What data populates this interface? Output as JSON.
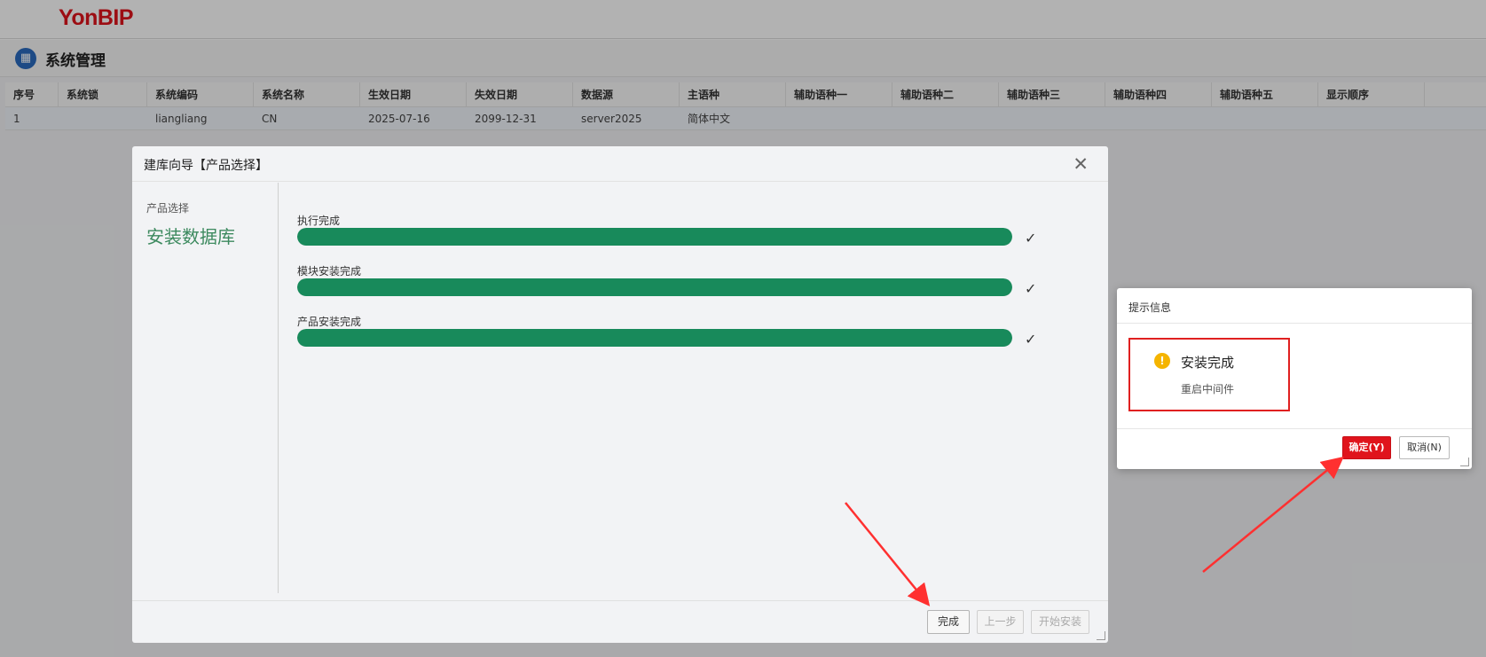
{
  "brand": {
    "logo_text": "YonBIP",
    "accent": "#e0141c"
  },
  "page": {
    "title": "系统管理",
    "title_icon": "grid-icon"
  },
  "table": {
    "columns": [
      "序号",
      "系统锁",
      "系统编码",
      "系统名称",
      "生效日期",
      "失效日期",
      "数据源",
      "主语种",
      "辅助语种一",
      "辅助语种二",
      "辅助语种三",
      "辅助语种四",
      "辅助语种五",
      "显示顺序"
    ],
    "rows": [
      [
        "1",
        "",
        "liangliang",
        "CN",
        "2025-07-16",
        "2099-12-31",
        "server2025",
        "简体中文",
        "",
        "",
        "",
        "",
        "",
        ""
      ]
    ]
  },
  "wizard": {
    "title": "建库向导【产品选择】",
    "close_icon": "close-icon",
    "steps": {
      "previous": "产品选择",
      "current": "安装数据库"
    },
    "progress": [
      {
        "label": "执行完成",
        "percent": 100,
        "status_icon": "check-icon"
      },
      {
        "label": "模块安装完成",
        "percent": 100,
        "status_icon": "check-icon"
      },
      {
        "label": "产品安装完成",
        "percent": 100,
        "status_icon": "check-icon"
      }
    ],
    "progress_color": "#188a5b",
    "buttons": {
      "finish": "完成",
      "prev": "上一步",
      "start": "开始安装"
    }
  },
  "message_box": {
    "title": "提示信息",
    "icon": "warning-icon",
    "main_text": "安装完成",
    "sub_text": "重启中间件",
    "ok_label": "确定(Y)",
    "cancel_label": "取消(N)"
  }
}
